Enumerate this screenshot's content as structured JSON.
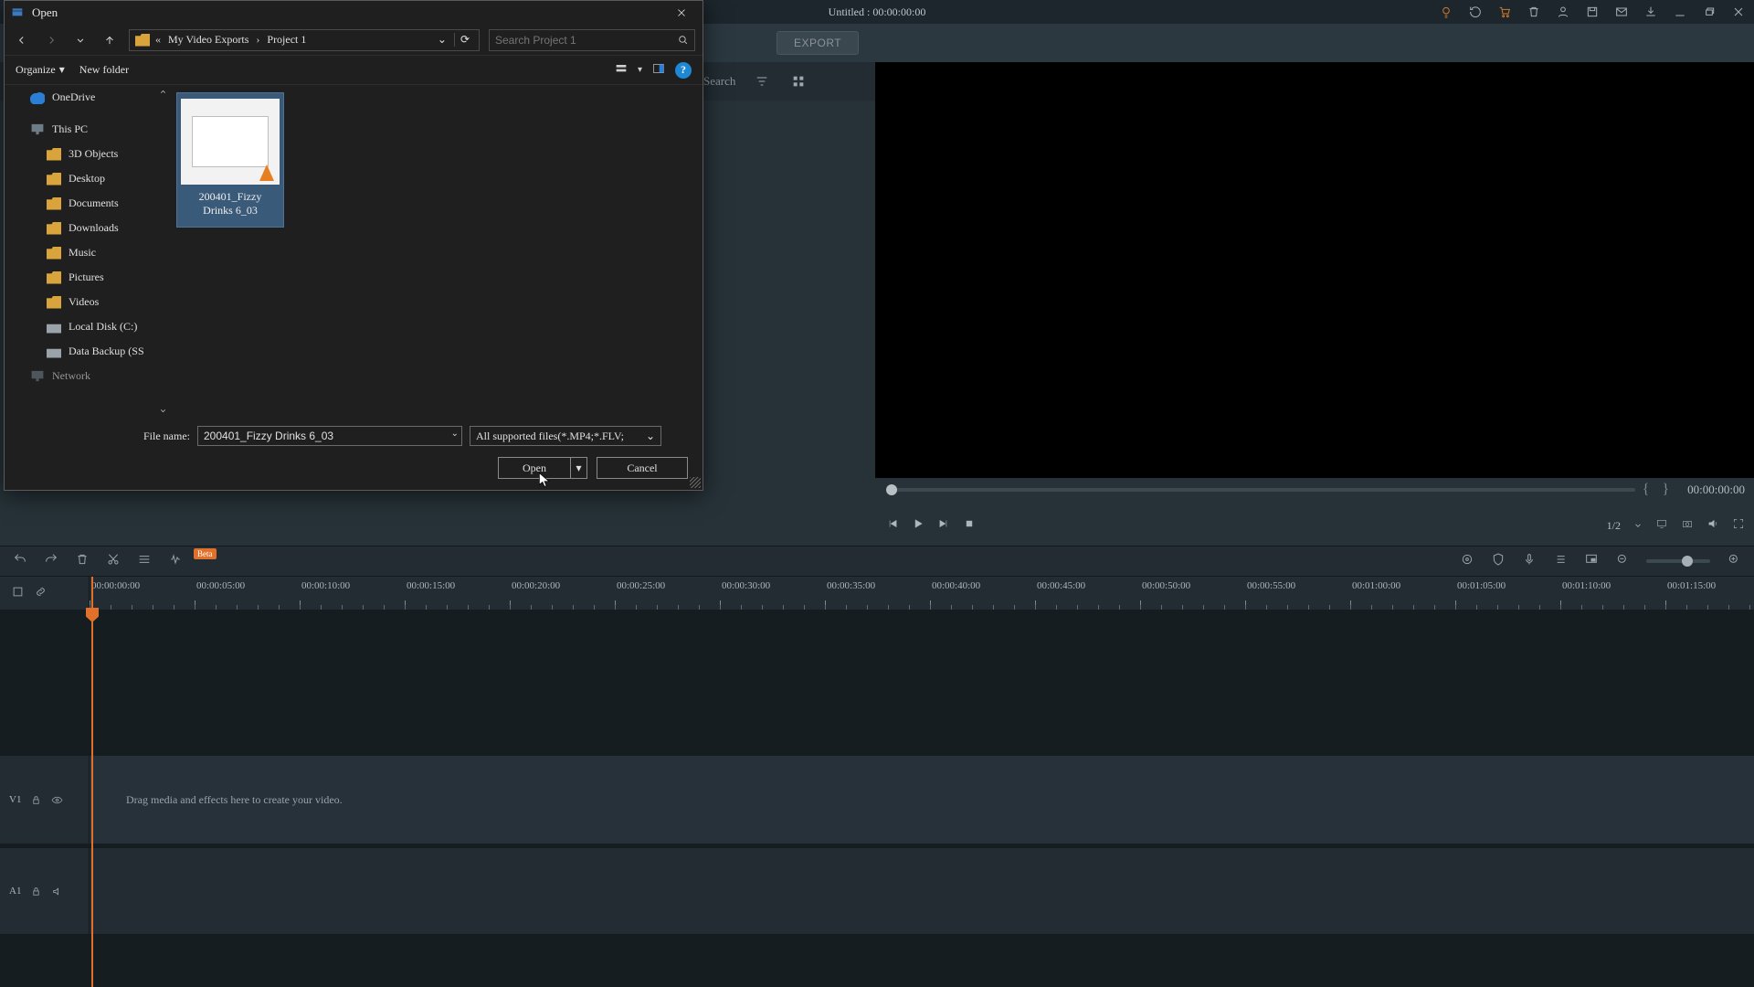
{
  "app": {
    "title": "Untitled : 00:00:00:00",
    "export_label": "EXPORT",
    "search_placeholder": "Search"
  },
  "preview": {
    "bracket_in": "{",
    "bracket_out": "}",
    "time": "00:00:00:00",
    "scale": "1/2"
  },
  "timeline": {
    "drop_hint": "Drag media and effects here to create your video.",
    "video_track_label": "V1",
    "audio_track_label": "A1",
    "beta_label": "Beta",
    "ruler": [
      "00:00:00:00",
      "00:00:05:00",
      "00:00:10:00",
      "00:00:15:00",
      "00:00:20:00",
      "00:00:25:00",
      "00:00:30:00",
      "00:00:35:00",
      "00:00:40:00",
      "00:00:45:00",
      "00:00:50:00",
      "00:00:55:00",
      "00:01:00:00",
      "00:01:05:00",
      "00:01:10:00",
      "00:01:15:00"
    ]
  },
  "dialog": {
    "title": "Open",
    "breadcrumb": {
      "prefix": "«",
      "seg1": "My Video Exports",
      "seg2": "Project 1"
    },
    "search_placeholder": "Search Project 1",
    "toolbar": {
      "organize": "Organize",
      "newfolder": "New folder"
    },
    "tree": {
      "onedrive": "OneDrive",
      "thispc": "This PC",
      "objects3d": "3D Objects",
      "desktop": "Desktop",
      "documents": "Documents",
      "downloads": "Downloads",
      "music": "Music",
      "pictures": "Pictures",
      "videos": "Videos",
      "localdisk": "Local Disk (C:)",
      "databackup": "Data Backup (SS",
      "network": "Network"
    },
    "file": {
      "label_line1": "200401_Fizzy",
      "label_line2": "Drinks 6_03"
    },
    "footer": {
      "filename_label": "File name:",
      "filename_value": "200401_Fizzy Drinks 6_03",
      "filetype_value": "All supported files(*.MP4;*.FLV;",
      "open": "Open",
      "cancel": "Cancel"
    }
  }
}
